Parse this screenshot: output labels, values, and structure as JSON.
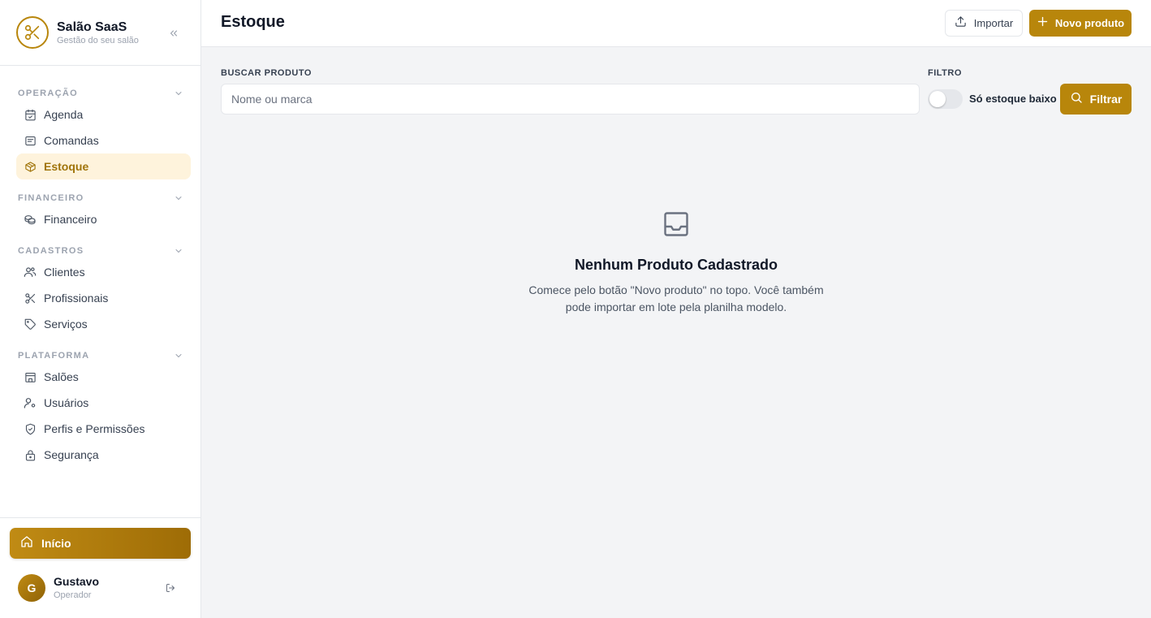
{
  "brand": {
    "name": "Salão SaaS",
    "subtitle": "Gestão do seu salão"
  },
  "sidebar": {
    "sections": [
      {
        "label": "OPERAÇÃO",
        "items": [
          {
            "label": "Agenda",
            "icon": "calendar-check-icon"
          },
          {
            "label": "Comandas",
            "icon": "receipt-icon"
          },
          {
            "label": "Estoque",
            "icon": "box-icon",
            "active": true
          }
        ]
      },
      {
        "label": "FINANCEIRO",
        "items": [
          {
            "label": "Financeiro",
            "icon": "coins-icon"
          }
        ]
      },
      {
        "label": "CADASTROS",
        "items": [
          {
            "label": "Clientes",
            "icon": "users-icon"
          },
          {
            "label": "Profissionais",
            "icon": "scissors-icon"
          },
          {
            "label": "Serviços",
            "icon": "tag-icon"
          }
        ]
      },
      {
        "label": "PLATAFORMA",
        "items": [
          {
            "label": "Salões",
            "icon": "store-icon"
          },
          {
            "label": "Usuários",
            "icon": "user-cog-icon"
          },
          {
            "label": "Perfis e Permissões",
            "icon": "shield-check-icon"
          },
          {
            "label": "Segurança",
            "icon": "lock-icon"
          }
        ]
      }
    ],
    "home_label": "Início",
    "user": {
      "initial": "G",
      "name": "Gustavo",
      "role": "Operador"
    }
  },
  "header": {
    "title": "Estoque",
    "import_label": "Importar",
    "new_label": "Novo produto"
  },
  "filters": {
    "search_label": "BUSCAR PRODUTO",
    "search_placeholder": "Nome ou marca",
    "search_value": "",
    "filter_label": "FILTRO",
    "low_stock_label": "Só estoque baixo",
    "low_stock_on": false,
    "filter_button": "Filtrar"
  },
  "empty_state": {
    "title": "Nenhum Produto Cadastrado",
    "text": "Comece pelo botão \"Novo produto\" no topo. Você também pode importar em lote pela planilha modelo."
  },
  "colors": {
    "accent": "#b8860b",
    "accent_light": "#fef3dc",
    "background": "#f3f4f6"
  }
}
